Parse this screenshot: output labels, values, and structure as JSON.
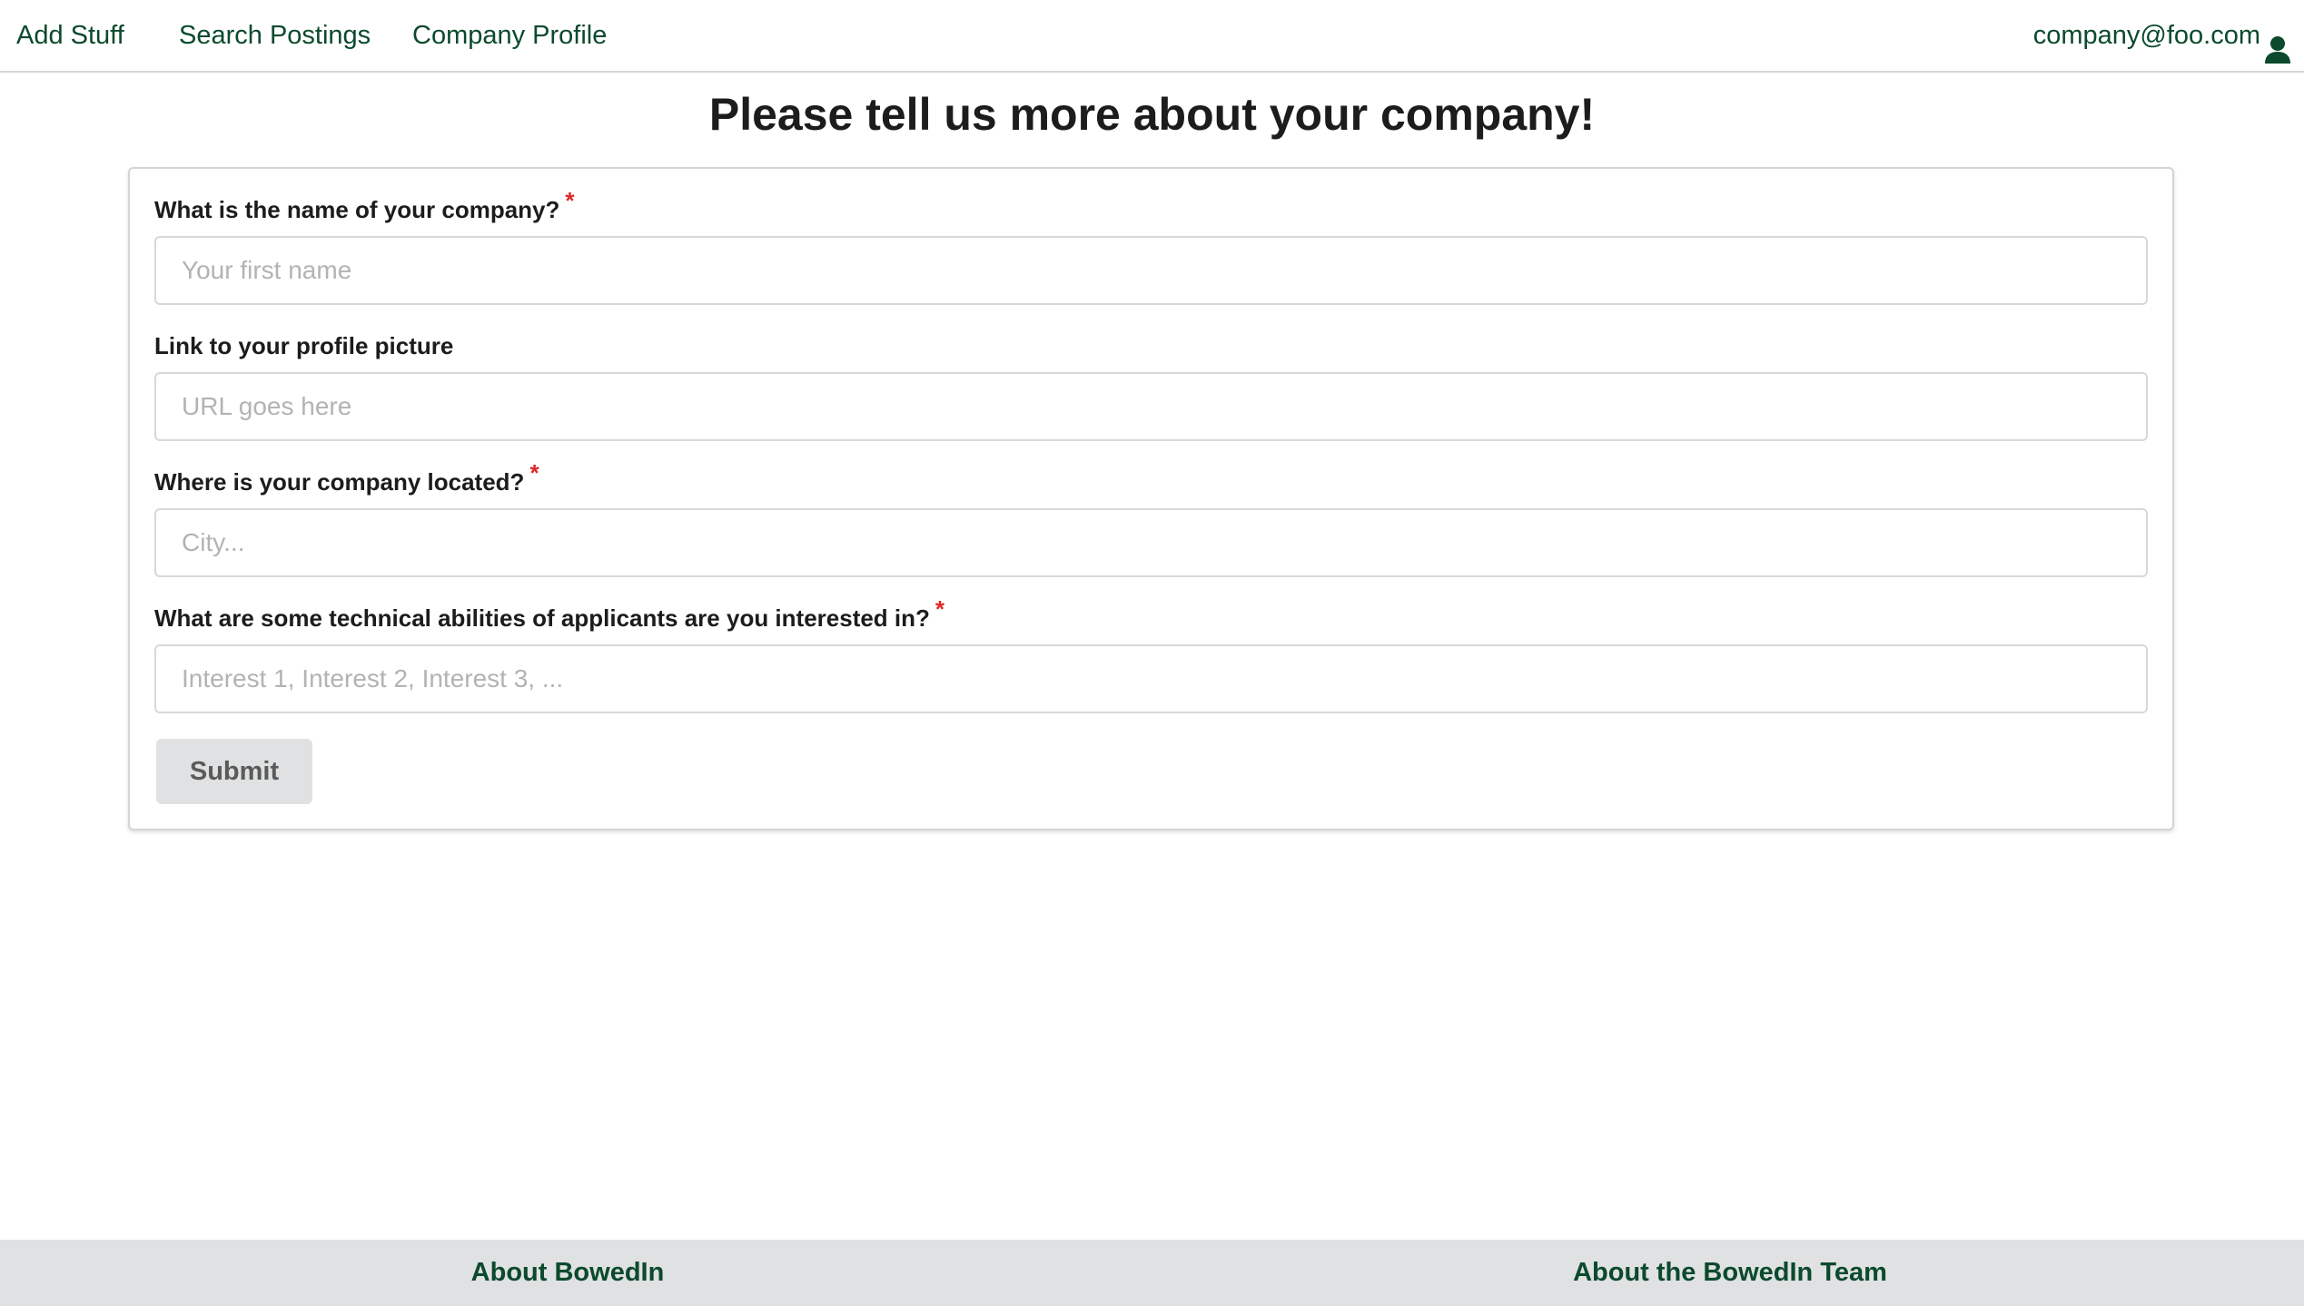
{
  "nav": {
    "add_stuff": "Add Stuff",
    "search_postings": "Search Postings",
    "company_profile": "Company Profile",
    "user_email": "company@foo.com",
    "user_icon": "user-icon"
  },
  "page": {
    "title": "Please tell us more about your company!"
  },
  "form": {
    "required_marker": "*",
    "fields": [
      {
        "label": "What is the name of your company?",
        "required": true,
        "placeholder": "Your first name",
        "value": ""
      },
      {
        "label": "Link to your profile picture",
        "required": false,
        "placeholder": "URL goes here",
        "value": ""
      },
      {
        "label": "Where is your company located?",
        "required": true,
        "placeholder": "City...",
        "value": ""
      },
      {
        "label": "What are some technical abilities of applicants are you interested in?",
        "required": true,
        "placeholder": "Interest 1, Interest 2, Interest 3, ...",
        "value": ""
      }
    ],
    "submit_label": "Submit"
  },
  "footer": {
    "about": "About BowedIn",
    "about_team": "About the BowedIn Team"
  },
  "colors": {
    "brand_green": "#0b4a2c",
    "required_red": "#db2828",
    "footer_bg": "#e0e1e2",
    "button_bg": "#e0e1e2"
  }
}
